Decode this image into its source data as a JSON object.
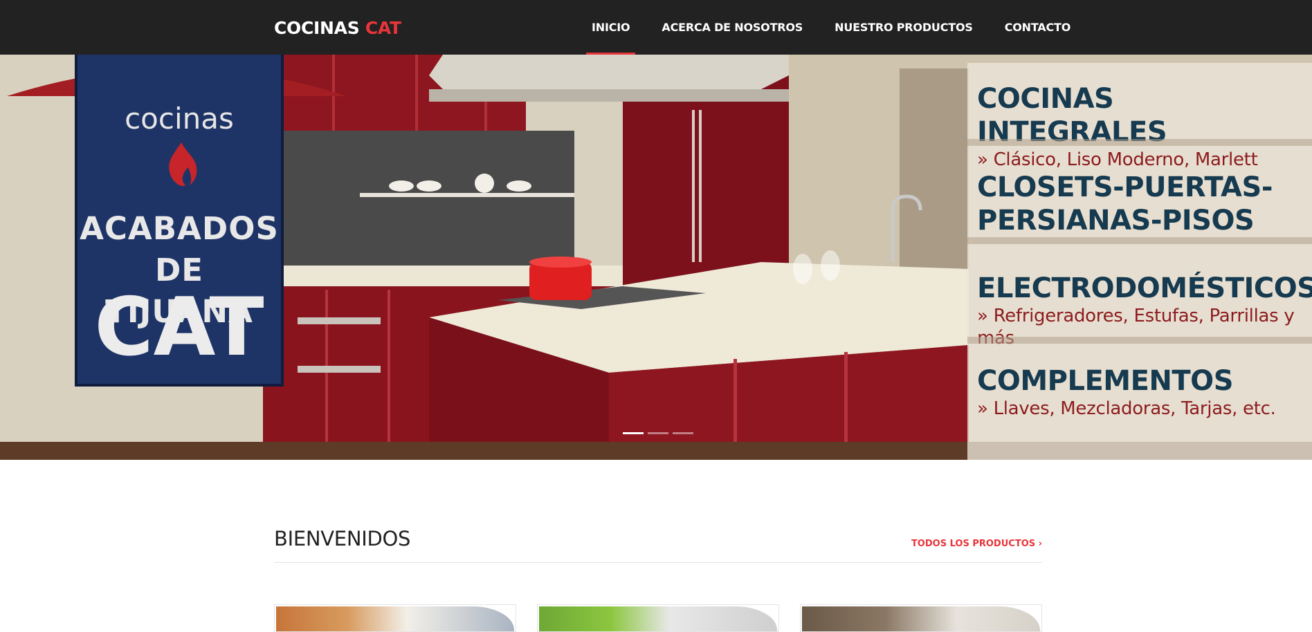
{
  "navbar": {
    "brand_main": "COCINAS",
    "brand_accent": "CAT",
    "items": [
      {
        "label": "INICIO",
        "active": true
      },
      {
        "label": "ACERCA DE NOSOTROS",
        "active": false
      },
      {
        "label": "NUESTRO PRODUCTOS",
        "active": false
      },
      {
        "label": "CONTACTO",
        "active": false
      }
    ]
  },
  "hero": {
    "logo": {
      "small": "cocinas",
      "line1": "ACABADOS",
      "line2": "DE TIJUANA",
      "big": "CAT"
    },
    "panel": [
      {
        "title": "COCINAS INTEGRALES",
        "sub": "» Clásico, Liso Moderno, Marlett"
      },
      {
        "title": "CLOSETS-PUERTAS-",
        "title2": "PERSIANAS-PISOS"
      },
      {
        "title": "ELECTRODOMÉSTICOS",
        "sub": "» Refrigeradores, Estufas, Parrillas y más"
      },
      {
        "title": "COMPLEMENTOS",
        "sub": "» Llaves, Mezcladoras, Tarjas, etc."
      }
    ],
    "slide_count": 3,
    "active_slide": 0
  },
  "welcome": {
    "title": "BIENVENIDOS",
    "all_products_label": "TODOS LOS PRODUCTOS ›"
  },
  "colors": {
    "navbar_bg": "#222222",
    "accent": "#e6353b",
    "cabinet_red": "#8e1620",
    "logo_blue": "#1f3466"
  }
}
